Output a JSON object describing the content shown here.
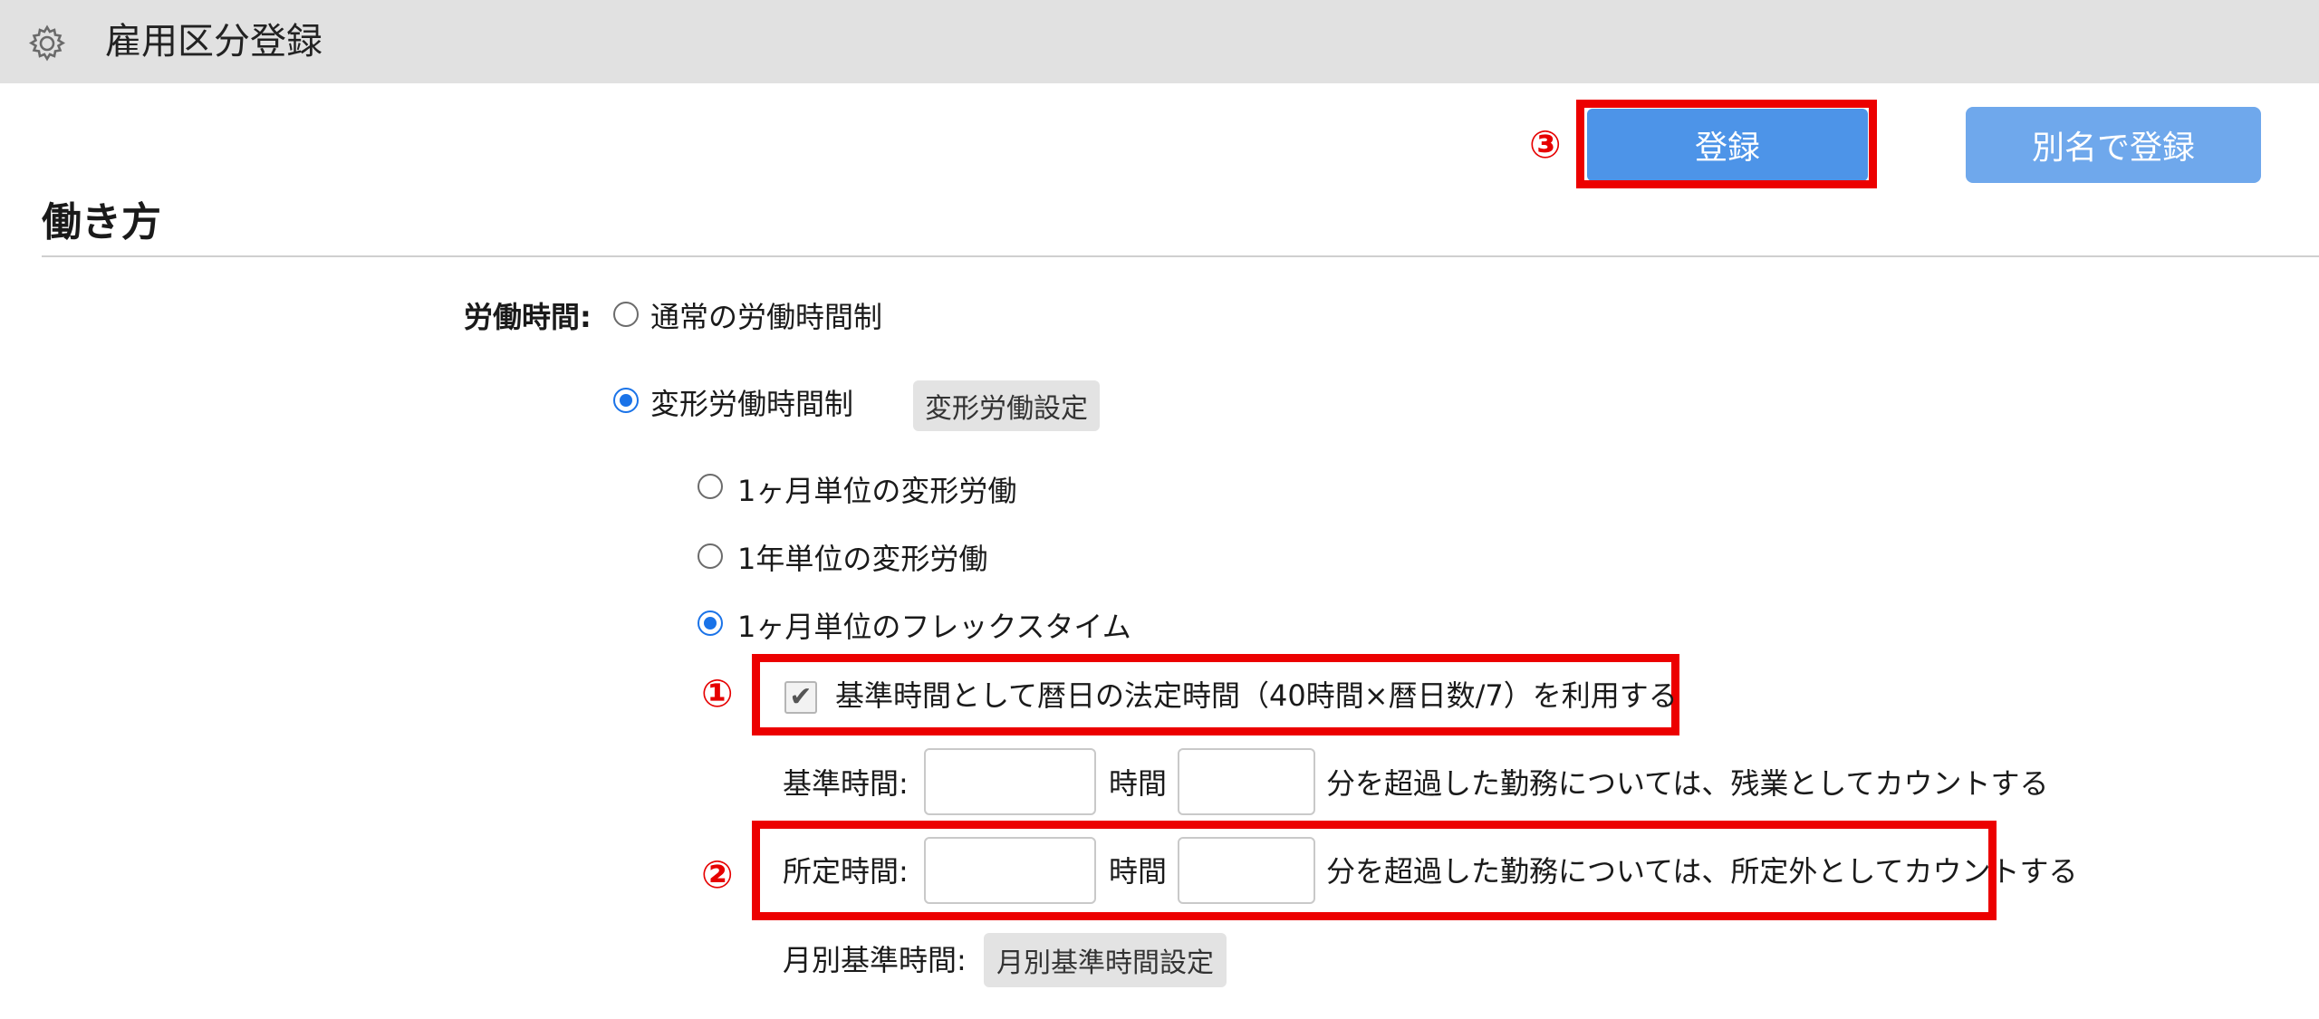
{
  "header": {
    "title": "雇用区分登録",
    "icon": "gear-icon"
  },
  "toolbar": {
    "register_label": "登録",
    "alias_register_label": "別名で登録"
  },
  "annotations": {
    "mark1": "①",
    "mark2": "②",
    "mark3": "③",
    "highlight_color": "#ec0000"
  },
  "section": {
    "title": "働き方"
  },
  "work_hours": {
    "label": "労働時間:",
    "options": [
      {
        "label": "通常の労働時間制",
        "selected": false
      },
      {
        "label": "変形労働時間制",
        "selected": true
      }
    ],
    "variable_settings_button": "変形労働設定",
    "sub_options": [
      {
        "label": "1ヶ月単位の変形労働",
        "selected": false
      },
      {
        "label": "1年単位の変形労働",
        "selected": false
      },
      {
        "label": "1ヶ月単位のフレックスタイム",
        "selected": true
      }
    ],
    "use_legal_hours_label": "基準時間として暦日の法定時間（40時間×暦日数/7）を利用する",
    "use_legal_hours_checked": true
  },
  "standard_time": {
    "label": "基準時間:",
    "hours_value": "",
    "hours_unit": "時間",
    "minutes_value": "",
    "suffix": "分を超過した勤務については、残業としてカウントする"
  },
  "scheduled_time": {
    "label": "所定時間:",
    "hours_value": "",
    "hours_unit": "時間",
    "minutes_value": "",
    "suffix": "分を超過した勤務については、所定外としてカウントする"
  },
  "monthly": {
    "label": "月別基準時間:",
    "button": "月別基準時間設定"
  },
  "colors": {
    "primary": "#4d94e8",
    "primary_light": "#6fa8ec",
    "header_bg": "#e1e1e1"
  }
}
